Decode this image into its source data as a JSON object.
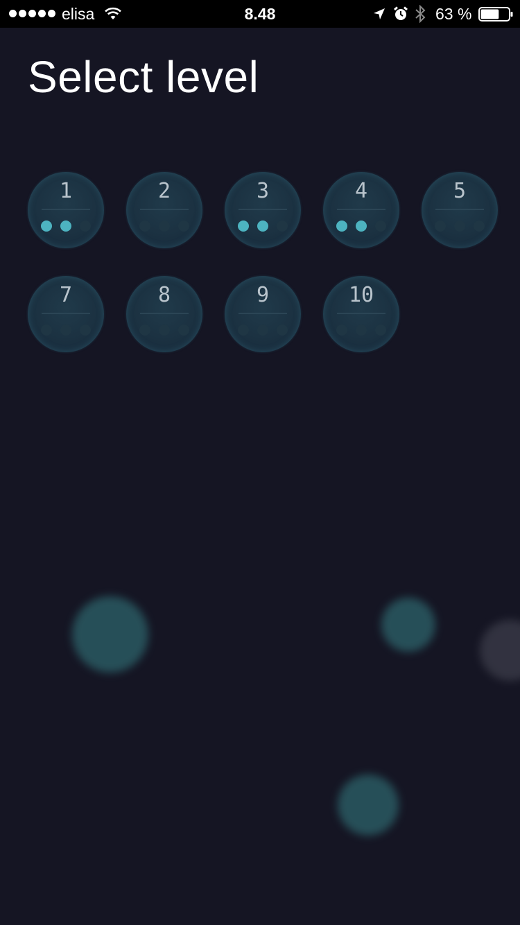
{
  "status_bar": {
    "carrier": "elisa",
    "time": "8.48",
    "battery_percent": "63 %",
    "battery_level": 0.63,
    "signal_bars": 5,
    "icons": [
      "signal-dots-icon",
      "wifi-icon",
      "location-arrow-icon",
      "alarm-clock-icon",
      "bluetooth-icon",
      "battery-icon"
    ]
  },
  "header": {
    "title": "Select level"
  },
  "levels": [
    {
      "number": "1",
      "stars_earned": 2,
      "stars_total": 3
    },
    {
      "number": "2",
      "stars_earned": 0,
      "stars_total": 3
    },
    {
      "number": "3",
      "stars_earned": 2,
      "stars_total": 3
    },
    {
      "number": "4",
      "stars_earned": 2,
      "stars_total": 3
    },
    {
      "number": "5",
      "stars_earned": 0,
      "stars_total": 3
    },
    {
      "number": "7",
      "stars_earned": 0,
      "stars_total": 3
    },
    {
      "number": "8",
      "stars_earned": 0,
      "stars_total": 3
    },
    {
      "number": "9",
      "stars_earned": 0,
      "stars_total": 3
    },
    {
      "number": "10",
      "stars_earned": 0,
      "stars_total": 3
    }
  ],
  "colors": {
    "background": "#151523",
    "tile": "#1b3141",
    "star_earned": "#4db3c0",
    "star_empty": "#1f3644",
    "level_number": "#b9c4cc",
    "bokeh_teal": "#2a5a62",
    "bokeh_gray": "#4a4b58"
  }
}
